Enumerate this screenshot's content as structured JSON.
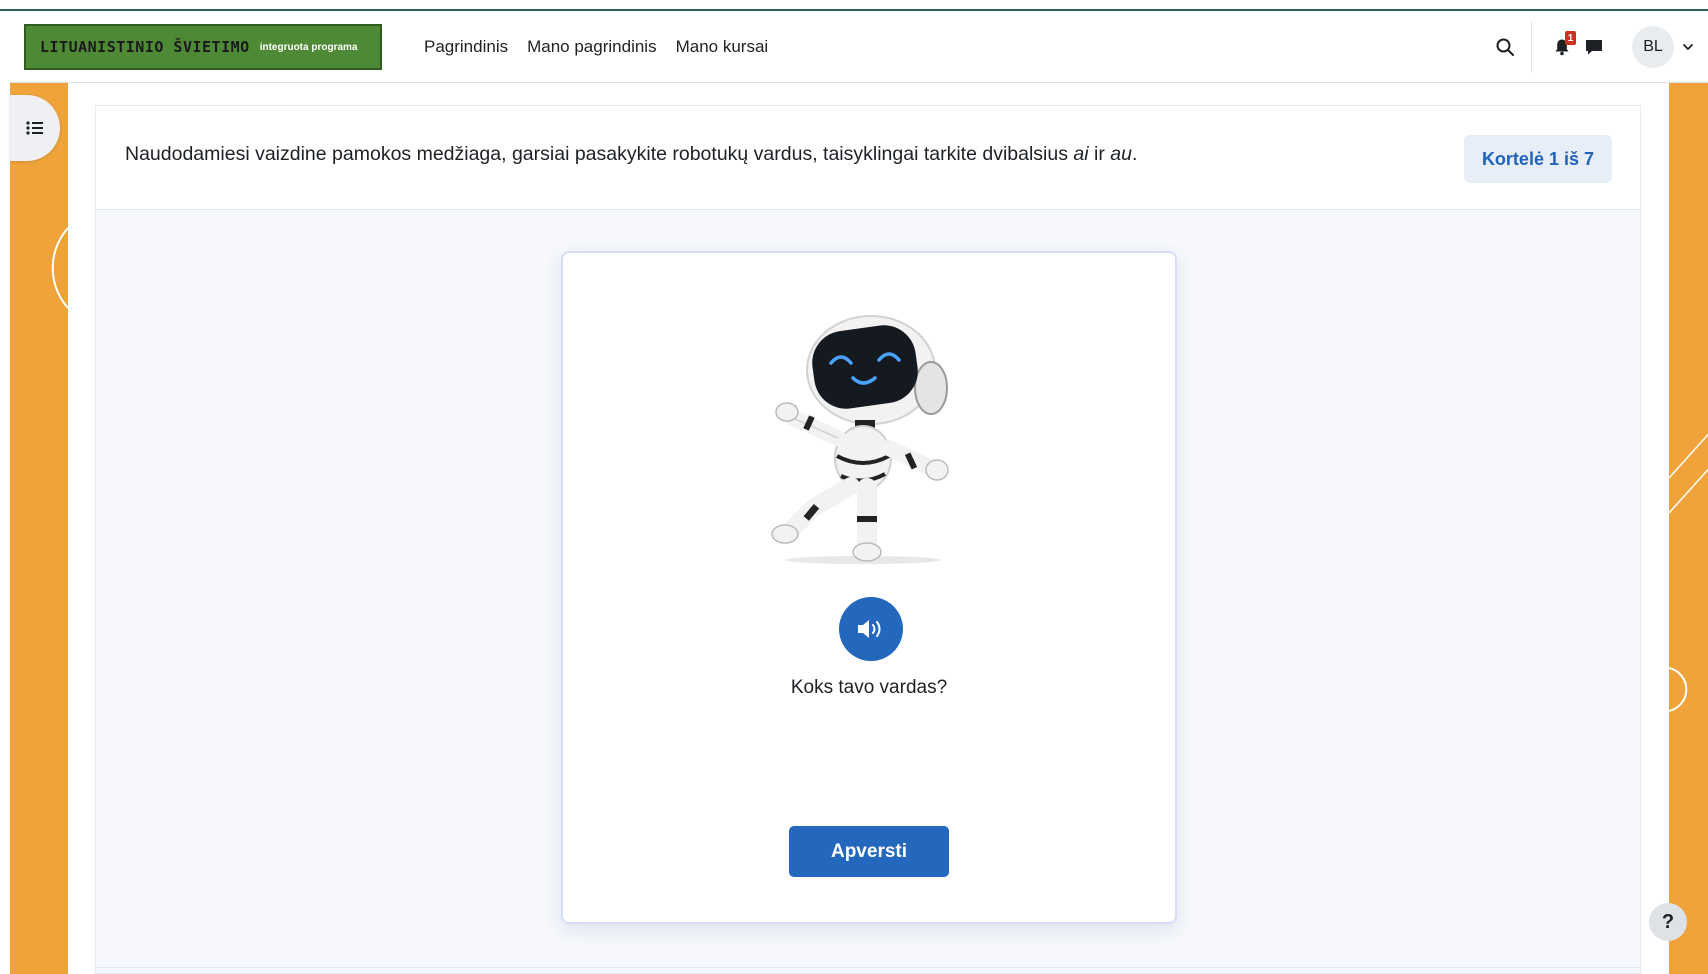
{
  "brand": {
    "logo_main": "LITUANISTINIO ŠVIETIMO",
    "logo_sub": "integruota programa",
    "colors": {
      "logo_bg": "#4e8a35",
      "accent": "#2368bd",
      "side_decor": "#f0a33b",
      "badge": "#ca3120"
    }
  },
  "nav": {
    "links": [
      "Pagrindinis",
      "Mano pagrindinis",
      "Mano kursai"
    ],
    "notifications_count": "1",
    "user_initials": "BL",
    "icons": {
      "search": "search-icon",
      "notifications": "bell-icon",
      "messages": "chat-icon",
      "user_menu": "chevron-down-icon"
    }
  },
  "drawer": {
    "icon": "list-icon"
  },
  "activity": {
    "instruction_before": "Naudodamiesi vaizdine pamokos medžiaga, garsiai pasakykite robotukų vardus, taisyklingai tarkite dvibalsius ",
    "instruction_em1": "ai",
    "instruction_mid": " ir ",
    "instruction_em2": "au",
    "instruction_after": ".",
    "counter": "Kortelė 1 iš 7"
  },
  "card": {
    "image": "robot-illustration",
    "audio_icon": "speaker-icon",
    "question": "Koks tavo vardas?",
    "flip_button": "Apversti"
  },
  "help": {
    "label": "?"
  }
}
